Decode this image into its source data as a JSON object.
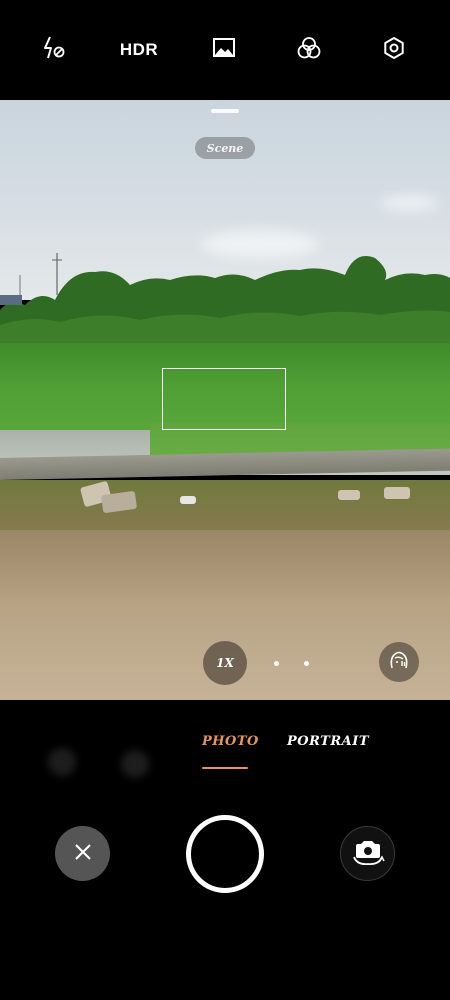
{
  "topbar": {
    "flash": {
      "icon": "flash-off-icon"
    },
    "hdr_label": "HDR",
    "gallery": {
      "icon": "image-icon"
    },
    "filters": {
      "icon": "filters-icon"
    },
    "settings": {
      "icon": "settings-hexagon-icon"
    }
  },
  "viewfinder": {
    "scene_label": "Scene",
    "zoom_label": "1X",
    "beauty": {
      "icon": "beauty-face-icon"
    }
  },
  "modes": [
    {
      "label": "PHOTO",
      "active": true
    },
    {
      "label": "PORTRAIT",
      "active": false
    }
  ],
  "controls": {
    "close": {
      "icon": "close-icon"
    },
    "shutter": {
      "icon": "shutter-icon"
    },
    "switch_camera": {
      "icon": "switch-camera-icon"
    }
  },
  "colors": {
    "accent": "#e8955a",
    "background": "#000000"
  }
}
